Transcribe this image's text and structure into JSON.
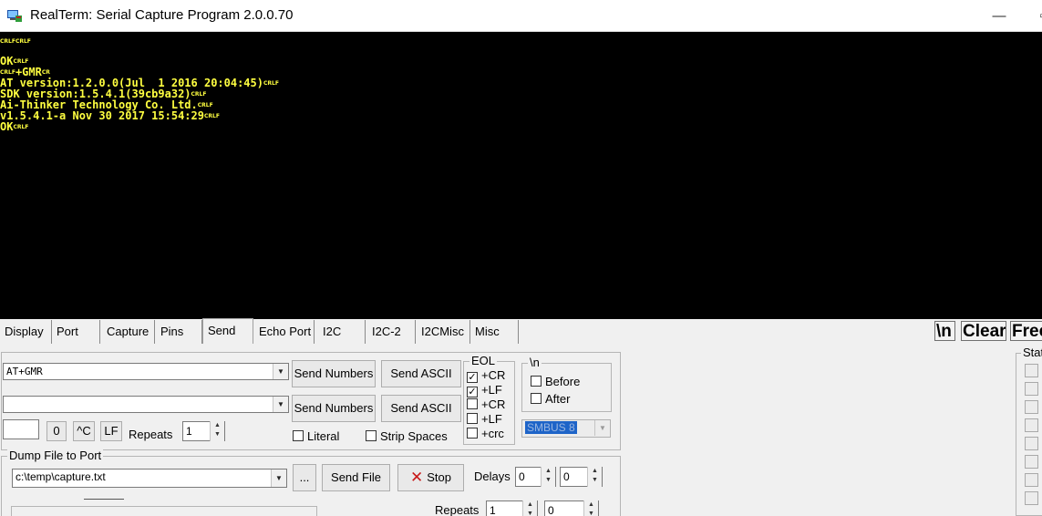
{
  "window": {
    "title": "RealTerm: Serial Capture Program 2.0.0.70",
    "minimize_glyph": "—",
    "close_glyph": "▫"
  },
  "terminal": {
    "text_color": "#ffff40",
    "lines": [
      {
        "text": "",
        "ctl": "CRLFCRLF"
      },
      {
        "text": "",
        "ctl": ""
      },
      {
        "text": "OK",
        "ctl": "CRLF"
      },
      {
        "text": "",
        "ctl": "CRLF",
        "pre": "",
        "mid": "+GMR",
        "tail": "CR"
      },
      {
        "text": "AT version:1.2.0.0(Jul  1 2016 20:04:45)",
        "ctl": "CRLF"
      },
      {
        "text": "SDK version:1.5.4.1(39cb9a32)",
        "ctl": "CRLF"
      },
      {
        "text": "Ai-Thinker Technology Co. Ltd.",
        "ctl": "CRLF"
      },
      {
        "text": "v1.5.4.1-a Nov 30 2017 15:54:29",
        "ctl": "CRLF"
      },
      {
        "text": "OK",
        "ctl": "CRLF"
      }
    ]
  },
  "tabs": [
    {
      "label": "Display"
    },
    {
      "label": "Port"
    },
    {
      "label": "Capture"
    },
    {
      "label": "Pins"
    },
    {
      "label": "Send",
      "active": true
    },
    {
      "label": "Echo Port"
    },
    {
      "label": "I2C"
    },
    {
      "label": "I2C-2"
    },
    {
      "label": "I2CMisc"
    },
    {
      "label": "Misc"
    }
  ],
  "toolbar_right": {
    "newline_label": "\\n",
    "clear_label": "Clear",
    "freeze_label": "Freeze"
  },
  "send": {
    "line1_value": "AT+GMR",
    "line2_value": "",
    "send_numbers_label": "Send Numbers",
    "send_ascii_label": "Send ASCII",
    "small_value": "",
    "zero_label": "0",
    "ctrl_c_label": "^C",
    "lf_label": "LF",
    "repeats_label": "Repeats",
    "repeats_value": "1",
    "literal_label": "Literal",
    "strip_spaces_label": "Strip Spaces",
    "eol": {
      "title": "EOL",
      "items": [
        {
          "label": "+CR",
          "checked": true
        },
        {
          "label": "+LF",
          "checked": true
        },
        {
          "label": "+CR",
          "checked": false
        },
        {
          "label": "+LF",
          "checked": false
        },
        {
          "label": "+crc",
          "checked": false
        }
      ]
    },
    "newline_group": {
      "title": "\\n",
      "before_label": "Before",
      "after_label": "After"
    },
    "crc_select_value": "SMBUS 8"
  },
  "dump": {
    "title": "Dump File to Port",
    "file_value": "c:\\temp\\capture.txt",
    "browse_label": "...",
    "send_file_label": "Send File",
    "stop_label": "Stop",
    "delays_label": "Delays",
    "delay1_value": "0",
    "delay2_value": "0",
    "repeats_label": "Repeats",
    "repeats1_value": "1",
    "repeats2_value": "0"
  },
  "status_group": {
    "title": "Status"
  }
}
